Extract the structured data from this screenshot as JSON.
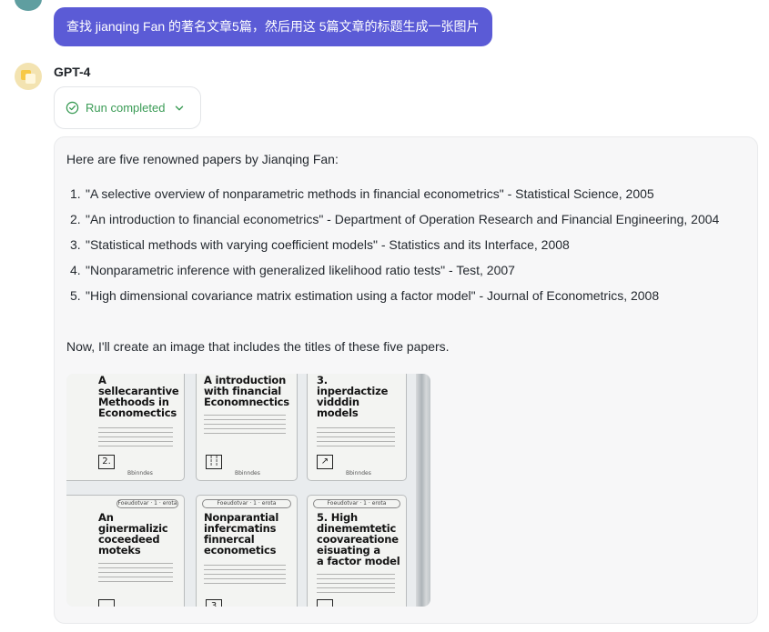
{
  "user_message": "查找 jianqing Fan 的著名文章5篇，然后用这 5篇文章的标题生成一张图片",
  "bot": {
    "name": "GPT-4",
    "run_status": "Run completed"
  },
  "response": {
    "intro": "Here are five renowned papers by Jianqing Fan:",
    "papers": [
      {
        "num": "1.",
        "text": "\"A selective overview of nonparametric methods in financial econometrics\" - Statistical Science, 2005"
      },
      {
        "num": "2.",
        "text": "\"An introduction to financial econometrics\" - Department of Operation Research and Financial Engineering, 2004"
      },
      {
        "num": "3.",
        "text": "\"Statistical methods with varying coefficient models\" - Statistics and its Interface, 2008"
      },
      {
        "num": "4.",
        "text": "\"Nonparametric inference with generalized likelihood ratio tests\" - Test, 2007"
      },
      {
        "num": "5.",
        "text": "\"High dimensional covariance matrix estimation using a factor model\" - Journal of Econometrics, 2008"
      }
    ],
    "outro": "Now, I'll create an image that includes the titles of these five papers."
  },
  "image": {
    "cards": [
      {
        "title": "A\nsellecarantive\nMethoods in\nEconomectics",
        "box": "2."
      },
      {
        "title": "A introduction\nwith financial\nEconomnectics",
        "box": "┆┆"
      },
      {
        "title": "3.\ninperdactize\nvidddin\nmodels",
        "box": "↗"
      },
      {
        "title": "An\nginermalizic\ncoceedeed\nmoteks",
        "box": ""
      },
      {
        "title": "Nonparantial\ninfercmatins\nfinnercal\neconometics",
        "box": "3"
      },
      {
        "title": "5. High\ndinememtetic\ncoovareatione\neisuating a\na factor model",
        "box": ""
      }
    ],
    "pill_text": "Foeudotvar · 1 · erota",
    "foot_text": "Bbinndes"
  }
}
